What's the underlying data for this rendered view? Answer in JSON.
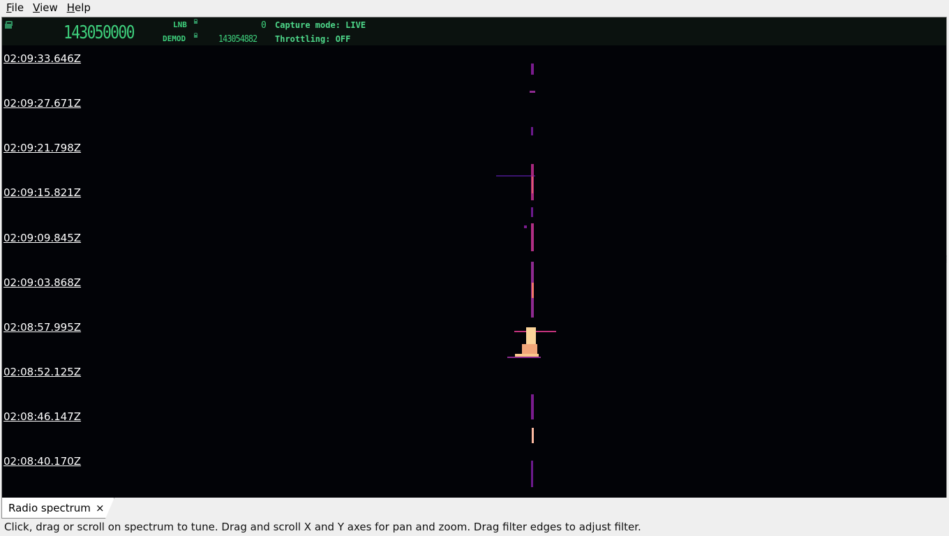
{
  "menu": {
    "file": "File",
    "view": "View",
    "help": "Help"
  },
  "frequency_panel": {
    "main_frequency": "143050000",
    "lnb_label": "LNB",
    "lnb_value": "0",
    "demod_label": "DEMOD",
    "demod_value": "143054882",
    "capture_mode": "Capture mode: LIVE",
    "throttling": "Throttling: OFF",
    "lcd_color": "#3ecf7c"
  },
  "waterfall": {
    "time_labels": [
      "02:09:33.646Z",
      "02:09:27.671Z",
      "02:09:21.798Z",
      "02:09:15.821Z",
      "02:09:09.845Z",
      "02:09:03.868Z",
      "02:08:57.995Z",
      "02:08:52.125Z",
      "02:08:46.147Z",
      "02:08:40.170Z"
    ],
    "background_color": "#020307",
    "signal_colors": [
      "#6b1a8c",
      "#c2337c",
      "#f2766a",
      "#fbd49a"
    ]
  },
  "tabs": [
    {
      "label": "Radio spectrum",
      "close": "×"
    }
  ],
  "status_text": "Click, drag or scroll on spectrum to tune. Drag and scroll X and Y axes for pan and zoom. Drag filter edges to adjust filter."
}
